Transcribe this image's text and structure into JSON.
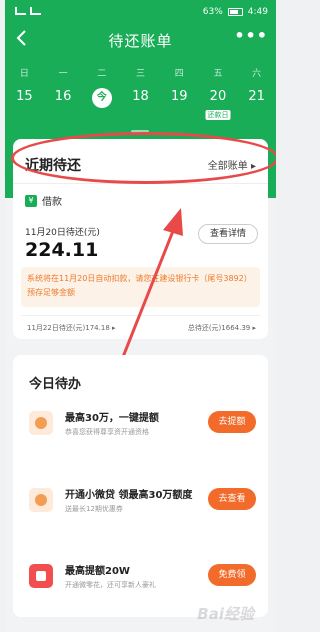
{
  "status_bar": {
    "battery": "63%",
    "time": "4:49"
  },
  "nav": {
    "title": "待还账单",
    "more": "•••"
  },
  "calendar": {
    "weekdays": [
      "日",
      "一",
      "二",
      "三",
      "四",
      "五",
      "六"
    ],
    "dates": [
      "15",
      "16",
      "今",
      "18",
      "19",
      "20",
      "21"
    ],
    "due_tag": "还款日"
  },
  "recent_card": {
    "title": "近期待还",
    "all_bills": "全部账单",
    "loan_tag": "借款",
    "due_label": "11月20日待还(元)",
    "amount": "224.11",
    "detail_button": "查看详情",
    "notice": "系统将在11月20日自动扣款，请您在建设银行卡（尾号3892）预存足够金额",
    "footer_left": "11月22日待还(元)174.18",
    "footer_right": "总待还(元)1664.39"
  },
  "todo_card": {
    "title": "今日待办",
    "items": [
      {
        "title": "最高30万，一键提额",
        "subtitle": "恭喜您获得尊享资开通资格",
        "button": "去提额"
      },
      {
        "title": "开通小微贷 领最高30万额度",
        "subtitle": "送最长12期优惠券",
        "button": "去查看"
      },
      {
        "title": "最高提额20W",
        "subtitle": "开通微零花，还可享新人豪礼",
        "button": "免费领"
      }
    ]
  },
  "watermark": "Bai经验",
  "colors": {
    "brand_green": "#19ad57",
    "accent_orange": "#f26b2a",
    "annotation_red": "#e84a4a"
  }
}
